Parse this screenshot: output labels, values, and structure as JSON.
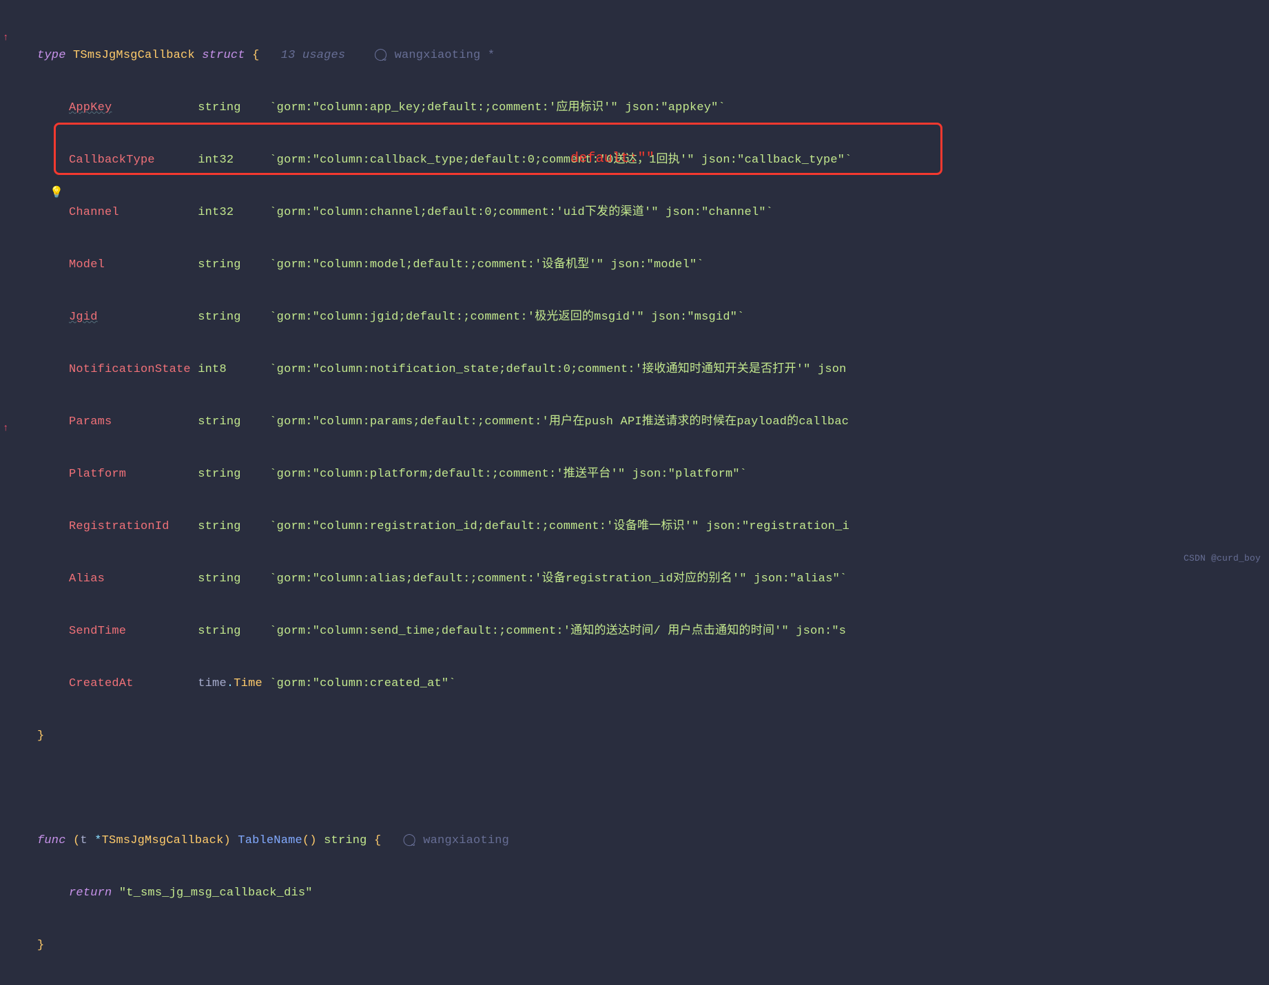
{
  "header": {
    "kw_type": "type",
    "struct_name": "TSmsJgMsgCallback",
    "kw_struct": "struct",
    "brace_open": "{",
    "usages": "13 usages",
    "author_prefix": "wangxiaoting *",
    "author_func": "wangxiaoting"
  },
  "fields": [
    {
      "name": "AppKey",
      "type": "string",
      "tag": "`gorm:\"column:app_key;default:;comment:'应用标识'\" json:\"appkey\"`",
      "wavy": false
    },
    {
      "name": "CallbackType",
      "type": "int32",
      "tag": "`gorm:\"column:callback_type;default:0;comment:'0送达，1回执'\" json:\"callback_type\"`",
      "wavy": false
    },
    {
      "name": "Channel",
      "type": "int32",
      "tag": "`gorm:\"column:channel;default:0;comment:'uid下发的渠道'\" json:\"channel\"`",
      "wavy": false
    },
    {
      "name": "Model",
      "type": "string",
      "tag": "`gorm:\"column:model;default:;comment:'设备机型'\" json:\"model\"`",
      "wavy": false
    },
    {
      "name": "Jgid",
      "type": "string",
      "tag": "`gorm:\"column:jgid;default:;comment:'极光返回的msgid'\" json:\"msgid\"`",
      "wavy": true
    },
    {
      "name": "NotificationState",
      "type": "int8",
      "tag": "`gorm:\"column:notification_state;default:0;comment:'接收通知时通知开关是否打开'\" json",
      "wavy": false
    },
    {
      "name": "Params",
      "type": "string",
      "tag": "`gorm:\"column:params;default:;comment:'用户在push API推送请求的时候在payload的callbac",
      "wavy": false
    },
    {
      "name": "Platform",
      "type": "string",
      "tag": "`gorm:\"column:platform;default:;comment:'推送平台'\" json:\"platform\"`",
      "wavy": false
    },
    {
      "name": "RegistrationId",
      "type": "string",
      "tag": "`gorm:\"column:registration_id;default:;comment:'设备唯一标识'\" json:\"registration_i",
      "wavy": false
    },
    {
      "name": "Alias",
      "type": "string",
      "tag": "`gorm:\"column:alias;default:;comment:'设备registration_id对应的别名'\" json:\"alias\"`",
      "wavy": false
    },
    {
      "name": "SendTime",
      "type": "string",
      "tag": "`gorm:\"column:send_time;default:;comment:'通知的送达时间/ 用户点击通知的时间'\" json:\"s",
      "wavy": false
    },
    {
      "name": "CreatedAt",
      "type": "time.Time",
      "tag": "`gorm:\"column:created_at\"`",
      "wavy": false
    }
  ],
  "closing_brace": "}",
  "func": {
    "kw_func": "func",
    "recv_open": "(",
    "recv_name": "t",
    "recv_star": "*",
    "recv_type": "TSmsJgMsgCallback",
    "recv_close": ")",
    "name": "TableName",
    "paren": "()",
    "ret_type": "string",
    "brace_open": "{",
    "kw_return": "return",
    "return_val": "\"t_sms_jg_msg_callback_dis\"",
    "brace_close": "}"
  },
  "annotation": {
    "text": "default:\"\""
  },
  "watermark": "CSDN @curd_boy"
}
